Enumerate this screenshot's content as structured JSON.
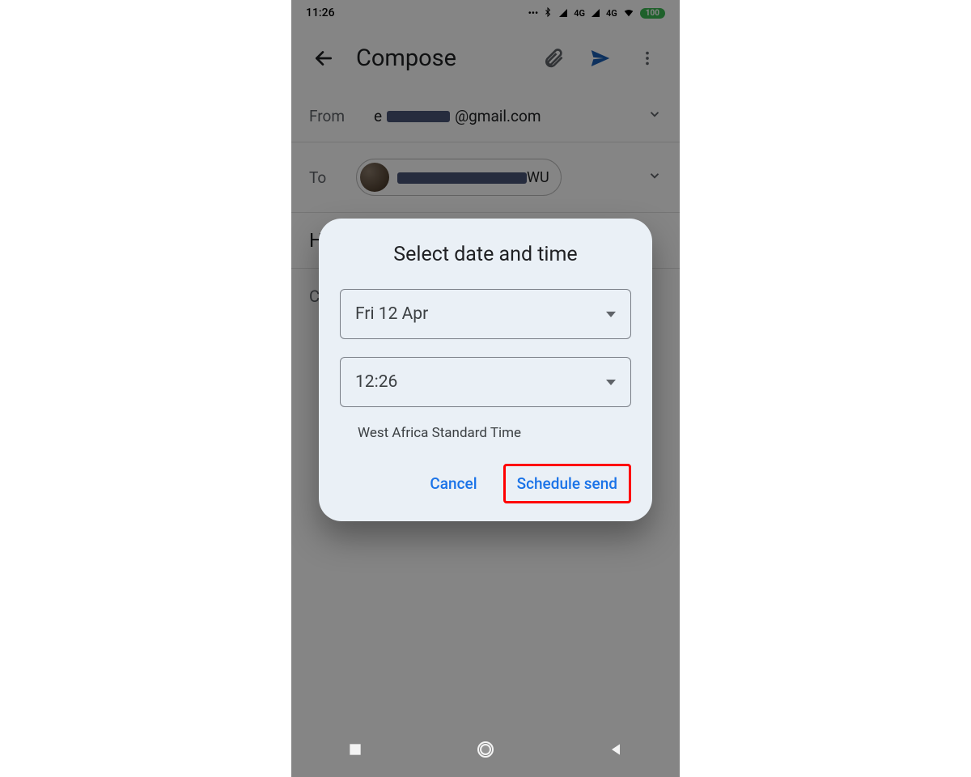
{
  "status": {
    "time": "11:26",
    "network1_label": "4G",
    "network2_label": "4G",
    "battery": "100"
  },
  "appbar": {
    "title": "Compose"
  },
  "fields": {
    "from_label": "From",
    "from_prefix": "e",
    "from_suffix": "@gmail.com",
    "to_label": "To",
    "to_suffix": "WU",
    "subject_hint": "H",
    "body_hint": "C"
  },
  "dialog": {
    "title": "Select date and time",
    "date_value": "Fri 12 Apr",
    "time_value": "12:26",
    "timezone": "West Africa Standard Time",
    "cancel_label": "Cancel",
    "confirm_label": "Schedule send"
  }
}
